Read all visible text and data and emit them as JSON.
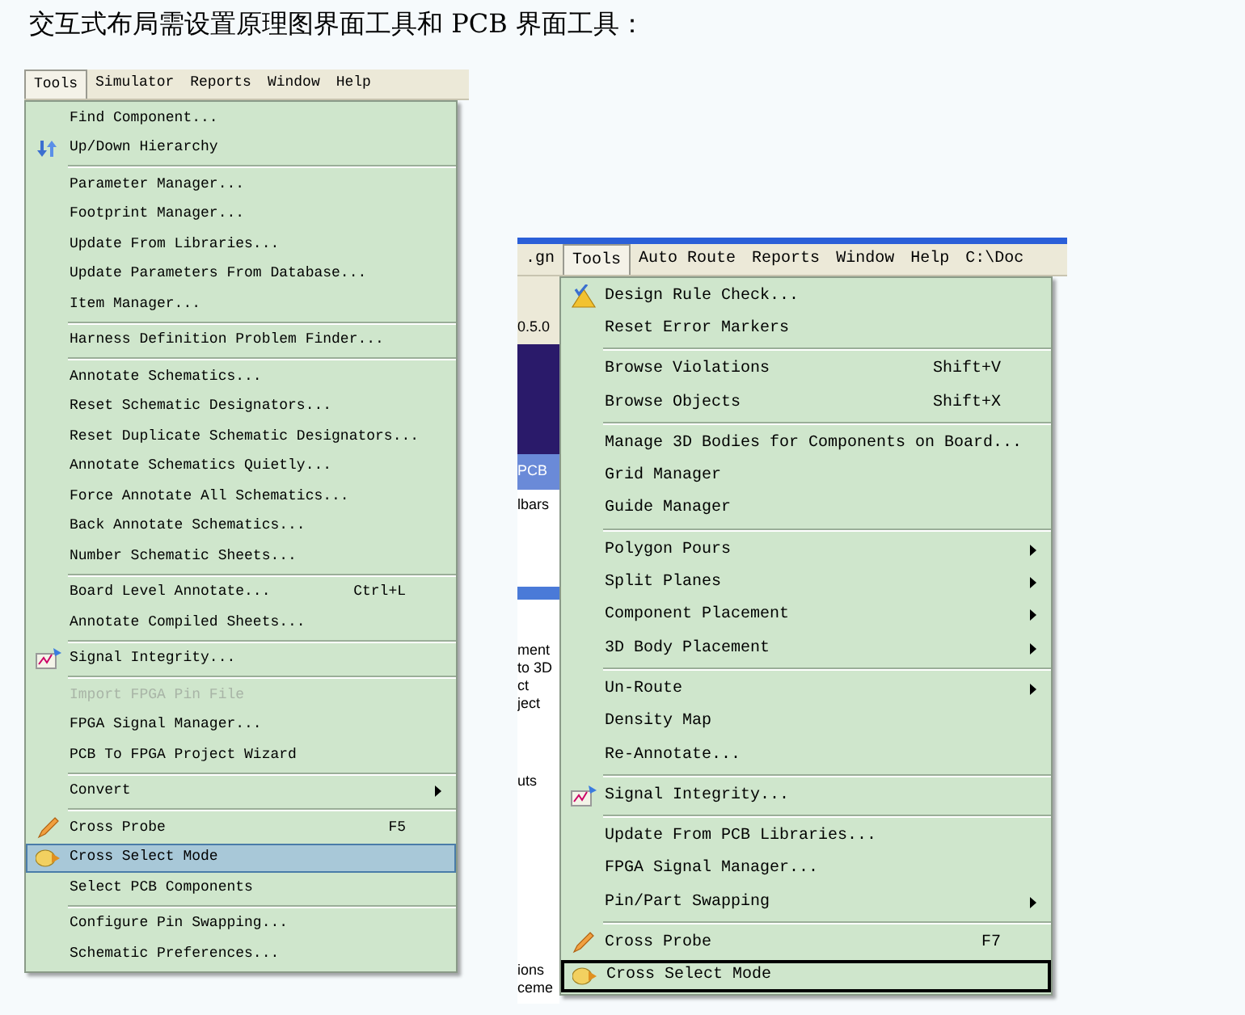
{
  "heading": "交互式布局需设置原理图界面工具和 PCB 界面工具：",
  "screenshots": [
    {
      "menubar": [
        {
          "label": "Tools",
          "selected": true
        },
        {
          "label": "Simulator",
          "selected": false
        },
        {
          "label": "Reports",
          "selected": false
        },
        {
          "label": "Window",
          "selected": false
        },
        {
          "label": "Help",
          "selected": false
        }
      ],
      "items": [
        {
          "kind": "item",
          "label": "Find Component...",
          "selected": false
        },
        {
          "kind": "arrows",
          "label": "Up/Down Hierarchy",
          "selected": false
        },
        {
          "kind": "separator"
        },
        {
          "kind": "item",
          "label": "Parameter Manager...",
          "selected": false
        },
        {
          "kind": "item",
          "label": "Footprint Manager...",
          "selected": false
        },
        {
          "kind": "item",
          "label": "Update From Libraries...",
          "selected": false
        },
        {
          "kind": "item",
          "label": "Update Parameters From Database...",
          "selected": false
        },
        {
          "kind": "item",
          "label": "Item Manager...",
          "selected": false
        },
        {
          "kind": "separator"
        },
        {
          "kind": "item",
          "label": "Harness Definition Problem Finder...",
          "selected": false
        },
        {
          "kind": "separator"
        },
        {
          "kind": "item",
          "label": "Annotate Schematics...",
          "selected": false
        },
        {
          "kind": "item",
          "label": "Reset Schematic Designators...",
          "selected": false
        },
        {
          "kind": "item",
          "label": "Reset Duplicate Schematic Designators...",
          "selected": false
        },
        {
          "kind": "item",
          "label": "Annotate Schematics Quietly...",
          "selected": false
        },
        {
          "kind": "item",
          "label": "Force Annotate All Schematics...",
          "selected": false
        },
        {
          "kind": "item",
          "label": "Back Annotate Schematics...",
          "selected": false
        },
        {
          "kind": "item",
          "label": "Number Schematic Sheets...",
          "selected": false
        },
        {
          "kind": "separator"
        },
        {
          "kind": "item",
          "label": "Board Level Annotate...",
          "shortcut": "Ctrl+L",
          "selected": false
        },
        {
          "kind": "item",
          "label": "Annotate Compiled Sheets...",
          "selected": false
        },
        {
          "kind": "separator"
        },
        {
          "kind": "chart",
          "label": "Signal Integrity...",
          "selected": false
        },
        {
          "kind": "separator"
        },
        {
          "kind": "item",
          "label": "Import FPGA Pin File",
          "disabled": true,
          "selected": false
        },
        {
          "kind": "item",
          "label": "FPGA Signal Manager...",
          "selected": false
        },
        {
          "kind": "item",
          "label": "PCB To FPGA Project Wizard",
          "selected": false
        },
        {
          "kind": "separator"
        },
        {
          "kind": "item",
          "label": "Convert",
          "submenu": true,
          "selected": false
        },
        {
          "kind": "separator"
        },
        {
          "kind": "pencil",
          "label": "Cross Probe",
          "shortcut": "F5",
          "selected": false
        },
        {
          "kind": "pointer",
          "label": "Cross Select Mode",
          "selected": true
        },
        {
          "kind": "item",
          "label": "Select PCB Components",
          "selected": false
        },
        {
          "kind": "separator"
        },
        {
          "kind": "item",
          "label": "Configure Pin Swapping...",
          "selected": false
        },
        {
          "kind": "item",
          "label": "Schematic Preferences...",
          "selected": false
        }
      ]
    },
    {
      "menubar": [
        {
          "label": ".gn",
          "selected": false
        },
        {
          "label": "Tools",
          "selected": true
        },
        {
          "label": "Auto Route",
          "selected": false
        },
        {
          "label": "Reports",
          "selected": false
        },
        {
          "label": "Window",
          "selected": false
        },
        {
          "label": "Help",
          "selected": false
        },
        {
          "label": "C:\\Doc",
          "selected": false
        }
      ],
      "background_fragments": [
        "0.5.0",
        "PCB",
        "lbars",
        "ment",
        "to 3D",
        "ct",
        "ject",
        "uts",
        "ions",
        "ceme"
      ],
      "items": [
        {
          "kind": "check",
          "label": "Design Rule Check...",
          "selected": false
        },
        {
          "kind": "item",
          "label": "Reset Error Markers",
          "selected": false
        },
        {
          "kind": "separator"
        },
        {
          "kind": "item",
          "label": "Browse Violations",
          "shortcut": "Shift+V",
          "selected": false
        },
        {
          "kind": "item",
          "label": "Browse Objects",
          "shortcut": "Shift+X",
          "selected": false
        },
        {
          "kind": "separator"
        },
        {
          "kind": "item",
          "label": "Manage 3D Bodies for Components on Board...",
          "selected": false
        },
        {
          "kind": "item",
          "label": "Grid Manager",
          "selected": false
        },
        {
          "kind": "item",
          "label": "Guide Manager",
          "selected": false
        },
        {
          "kind": "separator"
        },
        {
          "kind": "item",
          "label": "Polygon Pours",
          "submenu": true,
          "selected": false
        },
        {
          "kind": "item",
          "label": "Split Planes",
          "submenu": true,
          "selected": false
        },
        {
          "kind": "item",
          "label": "Component Placement",
          "submenu": true,
          "selected": false
        },
        {
          "kind": "item",
          "label": "3D Body Placement",
          "submenu": true,
          "selected": false
        },
        {
          "kind": "separator"
        },
        {
          "kind": "item",
          "label": "Un-Route",
          "submenu": true,
          "selected": false
        },
        {
          "kind": "item",
          "label": "Density Map",
          "selected": false
        },
        {
          "kind": "item",
          "label": "Re-Annotate...",
          "selected": false
        },
        {
          "kind": "separator"
        },
        {
          "kind": "chart",
          "label": "Signal Integrity...",
          "selected": false
        },
        {
          "kind": "separator"
        },
        {
          "kind": "item",
          "label": "Update From PCB Libraries...",
          "selected": false
        },
        {
          "kind": "item",
          "label": "FPGA Signal Manager...",
          "selected": false
        },
        {
          "kind": "item",
          "label": "Pin/Part Swapping",
          "submenu": true,
          "selected": false
        },
        {
          "kind": "separator"
        },
        {
          "kind": "pencil",
          "label": "Cross Probe",
          "shortcut": "F7",
          "selected": false
        },
        {
          "kind": "pointer",
          "label": "Cross Select Mode",
          "selected": true
        }
      ]
    }
  ]
}
